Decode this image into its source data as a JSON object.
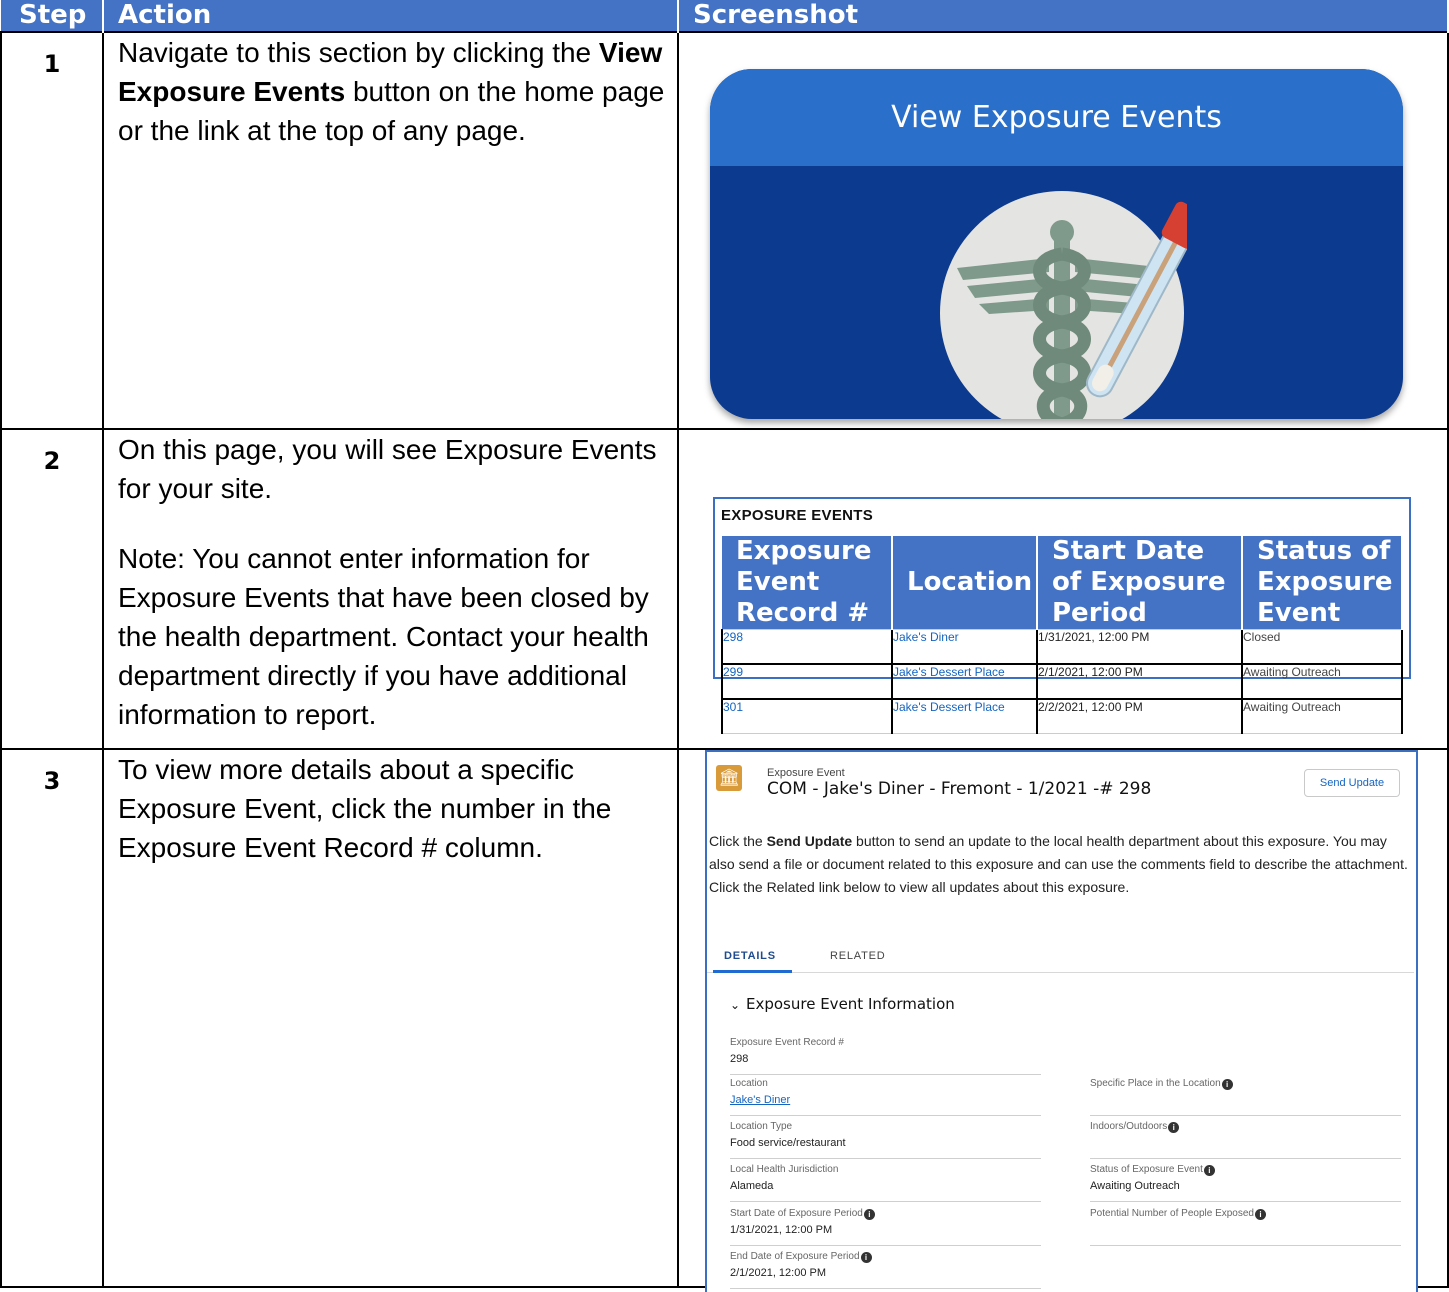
{
  "headers": {
    "step": "Step",
    "action": "Action",
    "screenshot": "Screenshot"
  },
  "rows": [
    {
      "step": "1",
      "action_before": "Navigate to this section by clicking the ",
      "action_bold": "View Exposure Events",
      "action_after": " button on the home page or the link at the top of any page."
    },
    {
      "step": "2",
      "action_p1": "On this page, you will see Exposure Events for your site.",
      "action_p2": "Note: You cannot enter information for Exposure Events that have been closed by the health department. Contact your health department directly if you have additional information to report."
    },
    {
      "step": "3",
      "action_p1": "To view more details about a specific Exposure Event, click the number in the Exposure Event Record # column."
    }
  ],
  "tile": {
    "label": "View Exposure Events",
    "icon": "caduceus-test-tube-icon",
    "colors": {
      "top": "#2a6fc9",
      "body": "#0b3a8f"
    }
  },
  "events_list": {
    "title": "EXPOSURE EVENTS",
    "columns": [
      "Exposure Event Record #",
      "Location",
      "Start Date of Exposure Period",
      "Status of Exposure Event"
    ],
    "rows": [
      {
        "record": "298",
        "location": "Jake's Diner",
        "start": "1/31/2021, 12:00 PM",
        "status": "Closed"
      },
      {
        "record": "299",
        "location": "Jake's Dessert Place",
        "start": "2/1/2021, 12:00 PM",
        "status": "Awaiting Outreach"
      },
      {
        "record": "301",
        "location": "Jake's Dessert Place",
        "start": "2/2/2021, 12:00 PM",
        "status": "Awaiting Outreach"
      }
    ]
  },
  "record": {
    "icon": "building-icon",
    "kind": "Exposure Event",
    "name": "COM - Jake's Diner - Fremont - 1/2021 -# 298",
    "send_update_label": "Send Update",
    "desc_before": "Click the ",
    "desc_bold": "Send Update",
    "desc_after": " button to send an update to the local health department about this exposure. You may also send a file or document related to this exposure and can use the comments field to describe the attachment. Click the Related link below to view all updates about this exposure.",
    "tabs": [
      "DETAILS",
      "RELATED"
    ],
    "section": "Exposure Event Information",
    "fields": {
      "record_no": {
        "label": "Exposure Event Record #",
        "value": "298"
      },
      "location": {
        "label": "Location",
        "value": "Jake's Diner"
      },
      "specific_place": {
        "label": "Specific Place in the Location",
        "value": ""
      },
      "location_type": {
        "label": "Location Type",
        "value": "Food service/restaurant"
      },
      "indoors": {
        "label": "Indoors/Outdoors",
        "value": ""
      },
      "jurisdiction": {
        "label": "Local Health Jurisdiction",
        "value": "Alameda"
      },
      "status": {
        "label": "Status of Exposure Event",
        "value": "Awaiting Outreach"
      },
      "start": {
        "label": "Start Date of Exposure Period",
        "value": "1/31/2021, 12:00 PM"
      },
      "potential": {
        "label": "Potential Number of People Exposed",
        "value": ""
      },
      "end": {
        "label": "End Date of Exposure Period",
        "value": "2/1/2021, 12:00 PM"
      }
    }
  }
}
